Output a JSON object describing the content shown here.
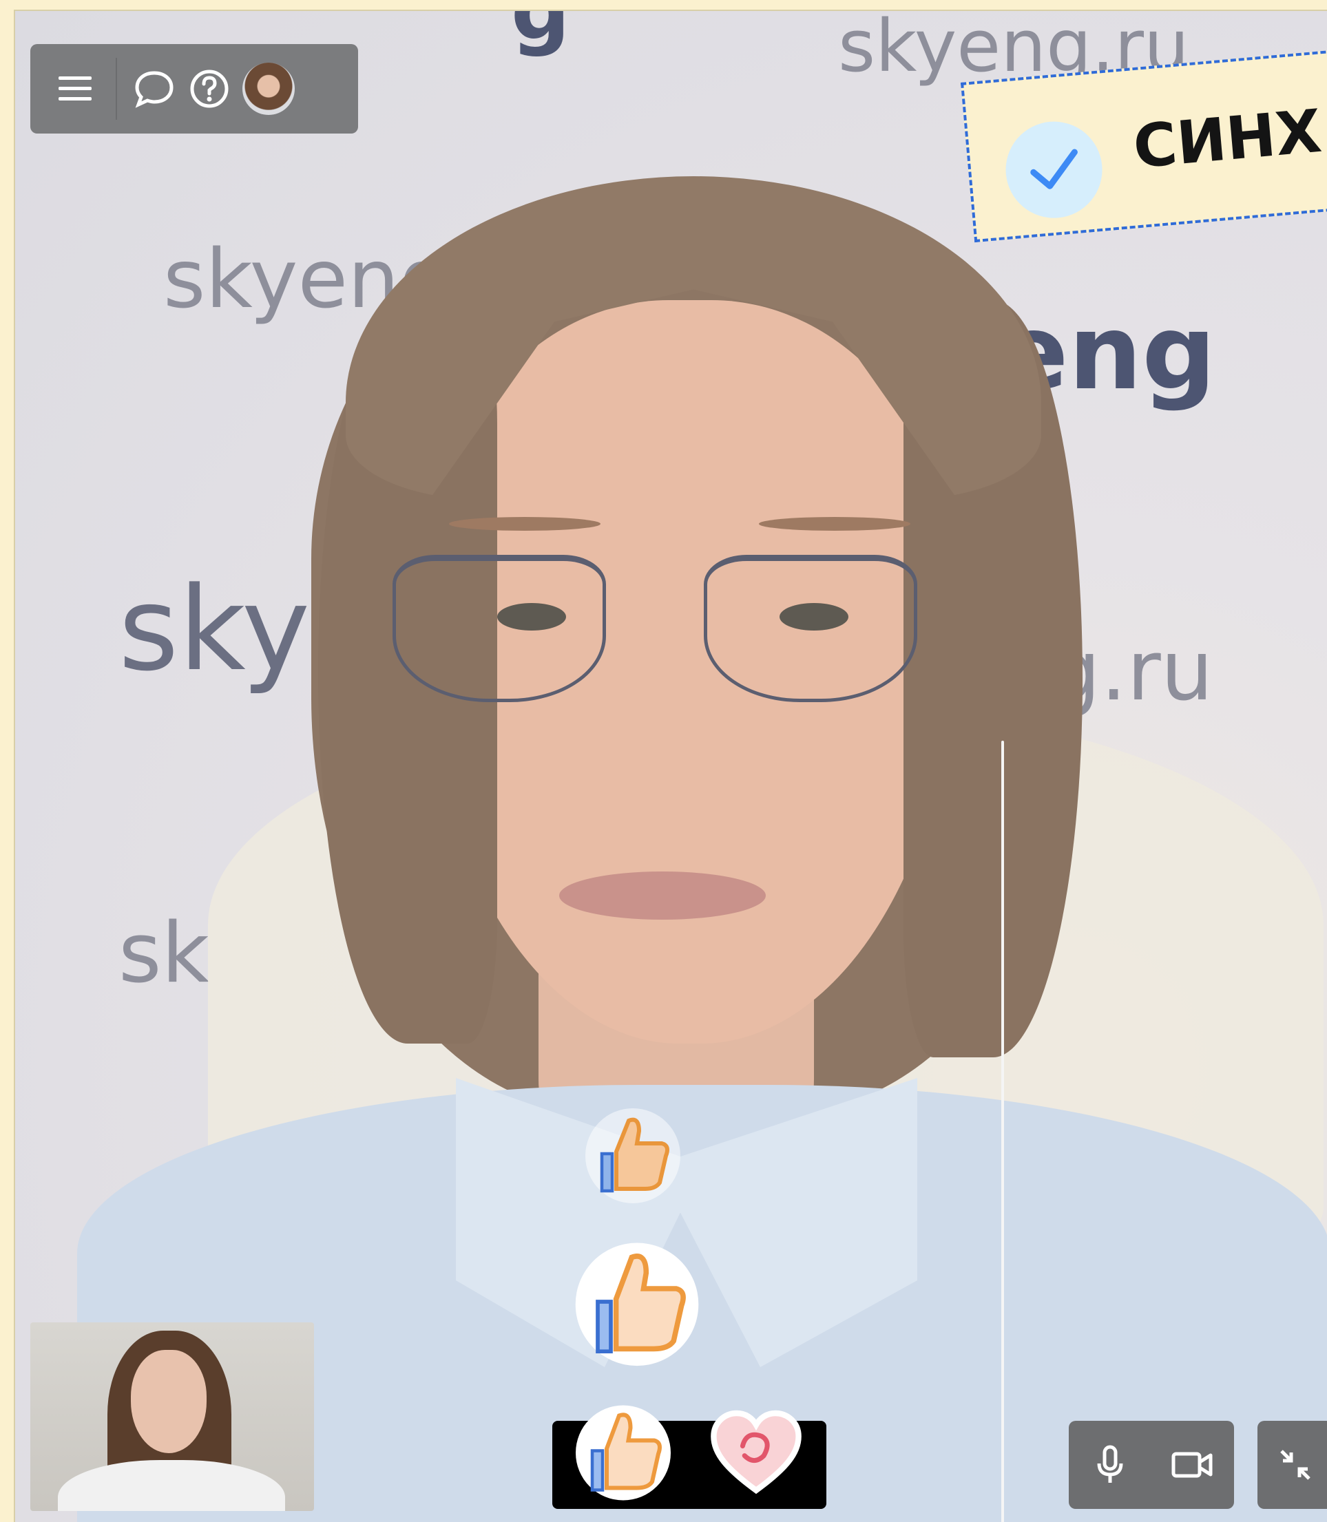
{
  "banner": {
    "text": "СИНХ"
  },
  "background_brand": {
    "words": [
      "skyeng.ru",
      "skyeng",
      "yeng",
      "sky",
      "g.ru",
      "sk",
      "g"
    ]
  },
  "toolbar": {
    "icons": [
      "menu-icon",
      "chat-icon",
      "help-icon",
      "avatar"
    ]
  },
  "reactions": {
    "floating": [
      "thumbs-up",
      "thumbs-up",
      "thumbs-up"
    ],
    "bar": [
      "thumbs-up",
      "heart"
    ]
  },
  "media_controls": {
    "icons": [
      "microphone-icon",
      "camera-icon",
      "shrink-icon"
    ]
  },
  "colors": {
    "accent": "#2f6bd8",
    "banner_bg": "#fbf1cf",
    "control_bg": "#6d6e70"
  }
}
